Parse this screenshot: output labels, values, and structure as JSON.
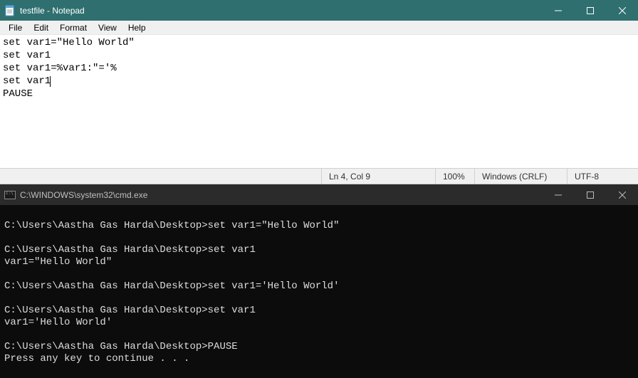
{
  "notepad": {
    "title": "testfile - Notepad",
    "menu": {
      "file": "File",
      "edit": "Edit",
      "format": "Format",
      "view": "View",
      "help": "Help"
    },
    "content": {
      "line1": "set var1=\"Hello World\"",
      "line2": "set var1",
      "line3": "set var1=%var1:\"='%",
      "line4": "set var1",
      "line5": "PAUSE"
    },
    "status": {
      "position": "Ln 4, Col 9",
      "zoom": "100%",
      "line_ending": "Windows (CRLF)",
      "encoding": "UTF-8"
    }
  },
  "cmd": {
    "title": "C:\\WINDOWS\\system32\\cmd.exe",
    "lines": {
      "l1": "C:\\Users\\Aastha Gas Harda\\Desktop>set var1=\"Hello World\"",
      "l2": "",
      "l3": "C:\\Users\\Aastha Gas Harda\\Desktop>set var1",
      "l4": "var1=\"Hello World\"",
      "l5": "",
      "l6": "C:\\Users\\Aastha Gas Harda\\Desktop>set var1='Hello World'",
      "l7": "",
      "l8": "C:\\Users\\Aastha Gas Harda\\Desktop>set var1",
      "l9": "var1='Hello World'",
      "l10": "",
      "l11": "C:\\Users\\Aastha Gas Harda\\Desktop>PAUSE",
      "l12": "Press any key to continue . . ."
    }
  }
}
